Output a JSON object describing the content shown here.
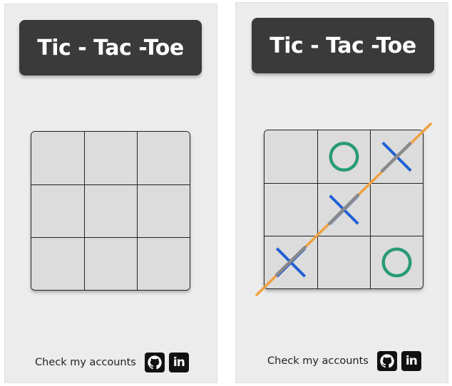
{
  "left_screen": {
    "title": "Tic - Tac -Toe",
    "board": [
      "",
      "",
      "",
      "",
      "",
      "",
      "",
      "",
      ""
    ],
    "footer": {
      "label": "Check my accounts",
      "icons": [
        "github-icon",
        "linkedin-icon"
      ],
      "linkedin_text": "in"
    }
  },
  "right_screen": {
    "title": "Tic - Tac -Toe",
    "board": [
      "",
      "O",
      "X",
      "",
      "X",
      "",
      "X",
      "",
      "O"
    ],
    "winning_line": "diagonal bottom-left to top-right",
    "footer": {
      "label": "Check my accounts",
      "icons": [
        "github-icon",
        "linkedin-icon"
      ],
      "linkedin_text": "in"
    }
  },
  "colors": {
    "x": "#1f5fd6",
    "o": "#2a9a78",
    "win_line": "#f0a040",
    "win_segment": "#8a8a8a",
    "title_bg": "#3a3a3a",
    "panel_bg": "#ececec",
    "cell_bg": "#dcdcdc"
  }
}
